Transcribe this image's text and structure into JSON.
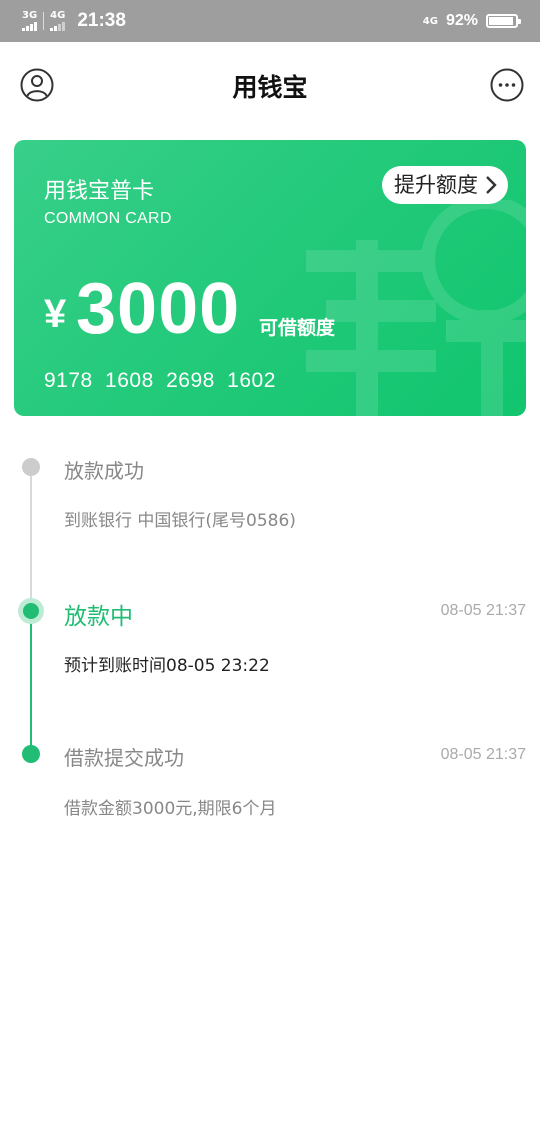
{
  "status_bar": {
    "network1": "3G",
    "network2": "4G",
    "time": "21:38",
    "network3": "4G",
    "battery_pct": "92%",
    "battery_level": 0.92
  },
  "header": {
    "title": "用钱宝",
    "left_icon": "user-icon",
    "right_icon": "more-icon"
  },
  "card": {
    "name": "用钱宝普卡",
    "subtitle": "COMMON CARD",
    "upgrade_button": "提升额度",
    "currency": "¥",
    "amount": "3000",
    "amount_label": "可借额度",
    "card_number": "9178 1608 2698 1602",
    "watermark_glyph": "钱",
    "colors": {
      "start": "#38cf8a",
      "end": "#11c56e"
    }
  },
  "timeline": {
    "items": [
      {
        "title": "放款成功",
        "time": "",
        "desc": "到账银行 中国银行(尾号0586)",
        "state": "pending"
      },
      {
        "title": "放款中",
        "time": "08-05 21:37",
        "desc": "预计到账时间08-05 23:22",
        "state": "active"
      },
      {
        "title": "借款提交成功",
        "time": "08-05 21:37",
        "desc": "借款金额3000元,期限6个月",
        "state": "done"
      }
    ],
    "colors": {
      "active": "#21bd74",
      "pending": "#cccccc",
      "text_muted": "#888888"
    }
  }
}
